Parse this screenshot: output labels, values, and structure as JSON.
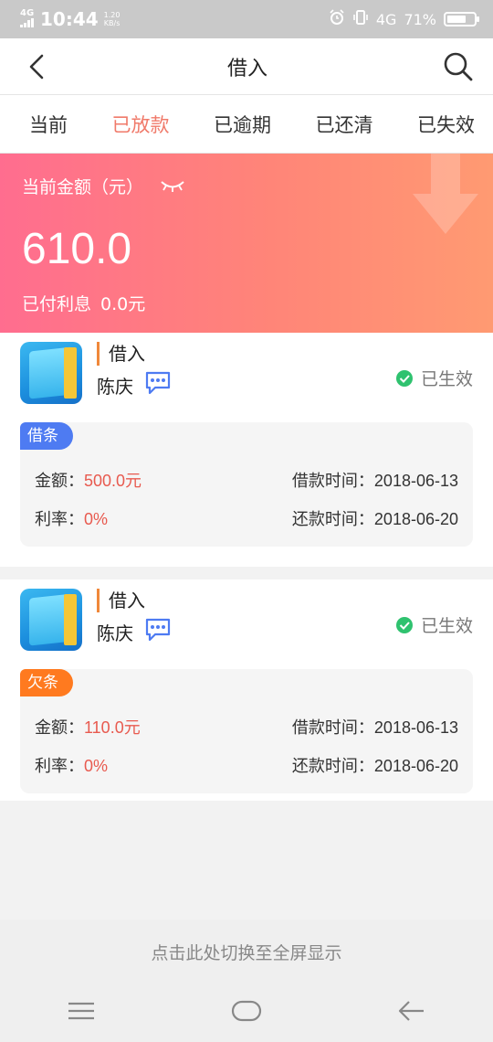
{
  "status_bar": {
    "network_left": "4G",
    "time": "10:44",
    "speed_value": "1.20",
    "speed_unit": "KB/s",
    "network_right": "4G",
    "battery": "71%",
    "battery_level": 0.71
  },
  "header": {
    "title": "借入",
    "back_icon": "back-arrow-icon",
    "search_icon": "search-icon"
  },
  "tabs": [
    {
      "label": "当前",
      "active": false
    },
    {
      "label": "已放款",
      "active": true
    },
    {
      "label": "已逾期",
      "active": false
    },
    {
      "label": "已还清",
      "active": false
    },
    {
      "label": "已失效",
      "active": false
    }
  ],
  "banner": {
    "label": "当前金额（元）",
    "amount": "610.0",
    "interest_label": "已付利息",
    "interest_value": "0.0元"
  },
  "loans": [
    {
      "title": "借入",
      "name": "陈庆",
      "status": "已生效",
      "tag": "借条",
      "tag_color": "#4e7bf2",
      "amount_label": "金额：",
      "amount": "500.0元",
      "rate_label": "利率：",
      "rate": "0%",
      "borrow_time_label": "借款时间：",
      "borrow_time": "2018-06-13",
      "repay_time_label": "还款时间：",
      "repay_time": "2018-06-20"
    },
    {
      "title": "借入",
      "name": "陈庆",
      "status": "已生效",
      "tag": "欠条",
      "tag_color": "#ff7a1f",
      "amount_label": "金额：",
      "amount": "110.0元",
      "rate_label": "利率：",
      "rate": "0%",
      "borrow_time_label": "借款时间：",
      "borrow_time": "2018-06-13",
      "repay_time_label": "还款时间：",
      "repay_time": "2018-06-20"
    }
  ],
  "footer": {
    "fullscreen_text": "点击此处切换至全屏显示"
  },
  "colors": {
    "accent": "#f07a6a",
    "banner_start": "#ff6d8f",
    "banner_end": "#ff9a72",
    "status_green": "#2fc26f",
    "amount_red": "#e85a4f"
  }
}
